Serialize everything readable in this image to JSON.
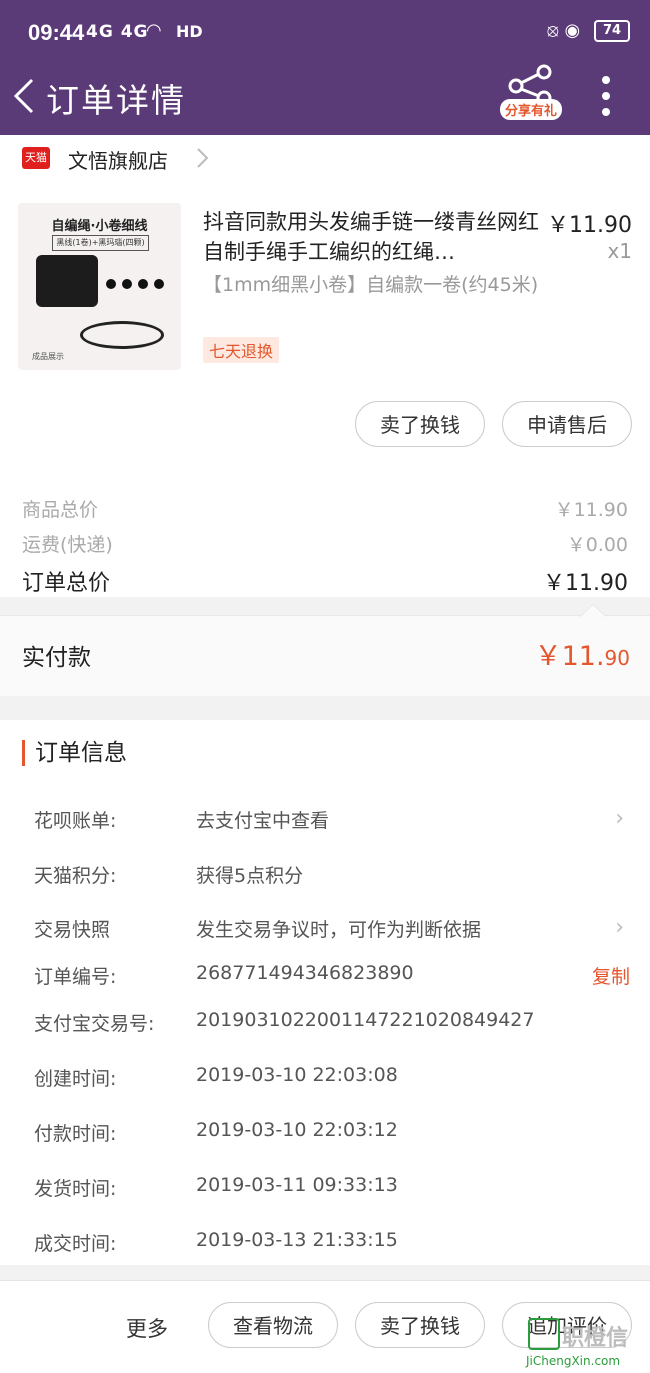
{
  "status_bar": {
    "time": "09:44",
    "network": "4G 4G",
    "hd": "HD",
    "battery": "74"
  },
  "nav": {
    "title": "订单详情",
    "share_label": "分享有礼"
  },
  "shop": {
    "badge": "天猫",
    "name": "文悟旗舰店"
  },
  "product": {
    "image_title": "自编绳·小卷细线",
    "image_sub": "黑线(1卷)+黑玛瑙(四颗)",
    "image_caption": "成品展示",
    "title": "抖音同款用头发编手链一缕青丝网红自制手绳手工编织的红绳…",
    "price": "￥11.90",
    "qty": "x1",
    "sku": "【1mm细黑小卷】自编款一卷(约45米)",
    "tag": "七天退换"
  },
  "item_actions": {
    "sell": "卖了换钱",
    "aftersale": "申请售后"
  },
  "summary": {
    "goods_label": "商品总价",
    "goods_value": "￥11.90",
    "shipping_label": "运费(快递)",
    "shipping_value": "￥0.00",
    "total_label": "订单总价",
    "total_value": "￥11.90",
    "paid_label": "实付款",
    "paid_int": "￥11.",
    "paid_dec": "90"
  },
  "order_info": {
    "title": "订单信息",
    "rows": [
      {
        "label": "花呗账单:",
        "value": "去支付宝中查看"
      },
      {
        "label": "天猫积分:",
        "value": "获得5点积分"
      },
      {
        "label": "交易快照",
        "value": "发生交易争议时，可作为判断依据"
      },
      {
        "label": "订单编号:",
        "value": "268771494346823890",
        "action": "复制"
      },
      {
        "label": "支付宝交易号:",
        "value": "2019031022001147221020849427"
      },
      {
        "label": "创建时间:",
        "value": "2019-03-10 22:03:08"
      },
      {
        "label": "付款时间:",
        "value": "2019-03-10 22:03:12"
      },
      {
        "label": "发货时间:",
        "value": "2019-03-11 09:33:13"
      },
      {
        "label": "成交时间:",
        "value": "2019-03-13 21:33:15"
      }
    ]
  },
  "bottom_bar": {
    "more": "更多",
    "logistics": "查看物流",
    "sell": "卖了换钱",
    "review": "追加评价"
  },
  "watermark": {
    "brand": "职橙信",
    "url": "JiChengXin.com"
  },
  "colors": {
    "header": "#5b3a78",
    "accent": "#e4572e",
    "tmall_red": "#e0201f"
  }
}
